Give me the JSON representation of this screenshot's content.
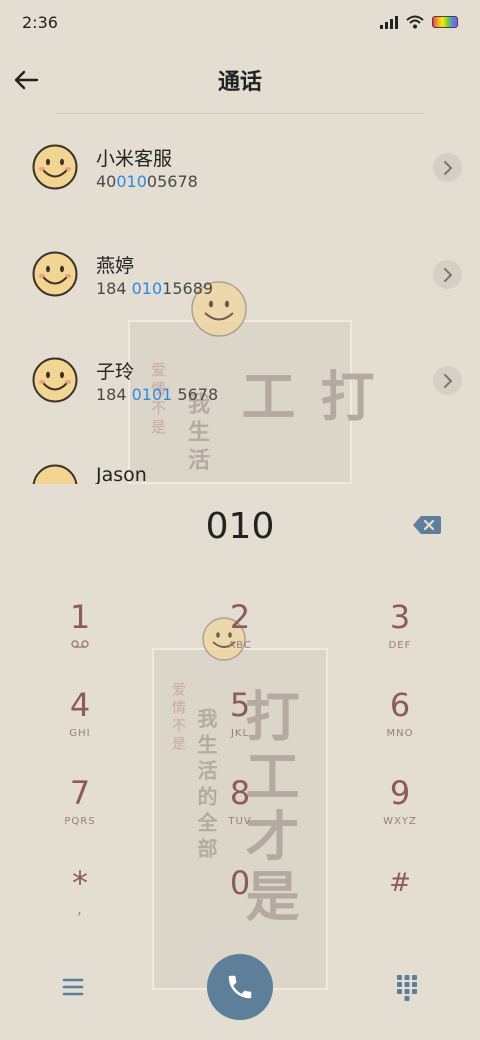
{
  "status_bar": {
    "time": "2:36"
  },
  "header": {
    "title": "通话"
  },
  "contacts": [
    {
      "name": "小米客服",
      "number_parts": [
        "40",
        "010",
        "05678"
      ]
    },
    {
      "name": "燕婷",
      "number_parts": [
        "184 ",
        "010",
        "15689"
      ]
    },
    {
      "name": "子玲",
      "number_parts": [
        "184 ",
        "0101",
        " 5678"
      ]
    },
    {
      "name": "Jason",
      "number_parts": [
        "",
        "",
        ""
      ]
    }
  ],
  "dialer": {
    "input": "010",
    "keys": [
      {
        "digit": "1",
        "letters": ""
      },
      {
        "digit": "2",
        "letters": "ABC"
      },
      {
        "digit": "3",
        "letters": "DEF"
      },
      {
        "digit": "4",
        "letters": "GHI"
      },
      {
        "digit": "5",
        "letters": "JKL"
      },
      {
        "digit": "6",
        "letters": "MNO"
      },
      {
        "digit": "7",
        "letters": "PQRS"
      },
      {
        "digit": "8",
        "letters": "TUV"
      },
      {
        "digit": "9",
        "letters": "WXYZ"
      },
      {
        "digit": "*",
        "letters": ","
      },
      {
        "digit": "0",
        "letters": ""
      },
      {
        "digit": "#",
        "letters": ""
      }
    ]
  },
  "watermark": {
    "big": "打工才是",
    "mid": "我生活的全部",
    "small": "爱情不是",
    "big_top": "打工",
    "mid_top": "我生活",
    "small_top": "爱情不是"
  },
  "colors": {
    "accent": "#2f8ae3",
    "call_button": "#5d7f99",
    "key_digit": "#8e5a5a",
    "background": "#e3ddd2"
  }
}
